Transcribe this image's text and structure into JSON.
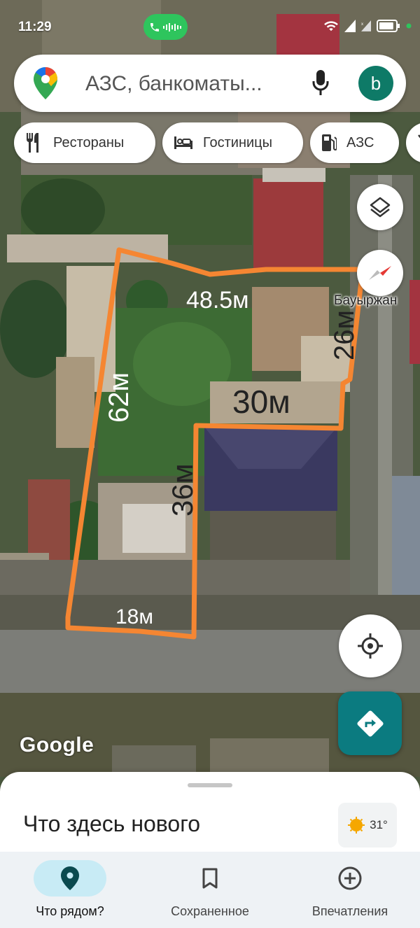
{
  "status_bar": {
    "time": "11:29",
    "battery_level": 0.9
  },
  "search": {
    "placeholder": "АЗС, банкоматы..."
  },
  "account": {
    "initial": "b",
    "color": "#0e7a67"
  },
  "chips": [
    {
      "label": "Рестораны",
      "icon": "restaurant-icon"
    },
    {
      "label": "Гостиницы",
      "icon": "hotel-icon"
    },
    {
      "label": "АЗС",
      "icon": "gas-station-icon"
    }
  ],
  "map": {
    "street_label": "Бауыржан",
    "attribution": "Google",
    "annotation_color": "#f58632",
    "measurements": [
      "48.5м",
      "26м",
      "30м",
      "62м",
      "36м",
      "18м"
    ]
  },
  "sheet": {
    "title": "Что здесь нового",
    "temperature": "31°"
  },
  "nav": [
    {
      "label": "Что рядом?",
      "icon": "explore-pin-icon",
      "active": true
    },
    {
      "label": "Сохраненное",
      "icon": "bookmark-icon",
      "active": false
    },
    {
      "label": "Впечатления",
      "icon": "add-circle-icon",
      "active": false
    }
  ]
}
